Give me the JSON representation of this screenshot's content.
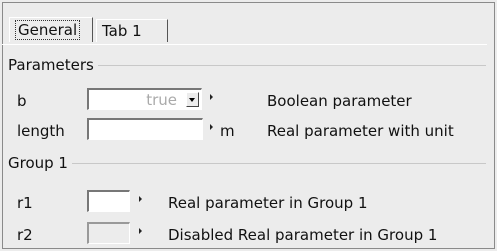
{
  "tabs": [
    {
      "label": "General",
      "active": true
    },
    {
      "label": "Tab 1",
      "active": false
    }
  ],
  "groups": {
    "parameters": {
      "title": "Parameters"
    },
    "group1": {
      "title": "Group 1"
    }
  },
  "params": {
    "b": {
      "name": "b",
      "value": "true",
      "description": "Boolean parameter"
    },
    "length": {
      "name": "length",
      "value": "",
      "unit": "m",
      "description": "Real parameter with unit"
    },
    "r1": {
      "name": "r1",
      "value": "",
      "description": "Real parameter in Group 1"
    },
    "r2": {
      "name": "r2",
      "value": "",
      "description": "Disabled Real parameter in Group 1"
    }
  },
  "colors": {
    "background": "#ececec",
    "field": "#ffffff",
    "disabled_text": "#aaaaaa"
  },
  "icons": [
    "dropdown-arrow-icon",
    "menu-arrow-icon"
  ]
}
